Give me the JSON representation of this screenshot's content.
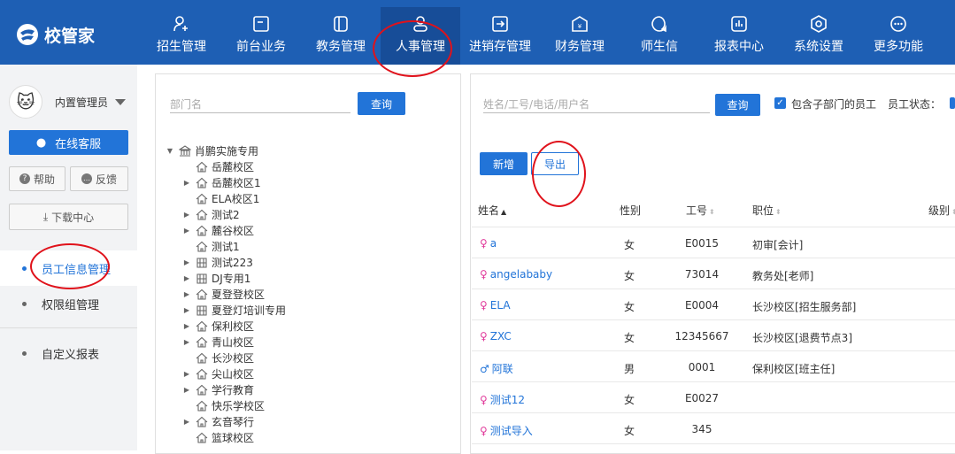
{
  "app": {
    "title": "校管家"
  },
  "nav": [
    {
      "label": "招生管理",
      "icon": "person-add-icon"
    },
    {
      "label": "前台业务",
      "icon": "monitor-icon"
    },
    {
      "label": "教务管理",
      "icon": "book-icon"
    },
    {
      "label": "人事管理",
      "icon": "person-icon",
      "active": true
    },
    {
      "label": "进销存管理",
      "icon": "inventory-icon"
    },
    {
      "label": "财务管理",
      "icon": "finance-icon"
    },
    {
      "label": "师生信",
      "icon": "chat-icon"
    },
    {
      "label": "报表中心",
      "icon": "report-icon"
    },
    {
      "label": "系统设置",
      "icon": "settings-icon"
    },
    {
      "label": "更多功能",
      "icon": "more-icon"
    }
  ],
  "sidebar": {
    "user": "内置管理员",
    "service": "在线客服",
    "help": "帮助",
    "feedback": "反馈",
    "download": "下载中心",
    "menu": [
      "员工信息管理",
      "权限组管理",
      "自定义报表"
    ]
  },
  "dept": {
    "placeholder": "部门名",
    "query": "查询",
    "tree": [
      {
        "label": "肖鹏实施专用",
        "arrow": "down",
        "icon": "bank-icon",
        "level": 0
      },
      {
        "label": "岳麓校区",
        "arrow": "",
        "icon": "home-icon",
        "level": 1
      },
      {
        "label": "岳麓校区1",
        "arrow": "right",
        "icon": "home-icon",
        "level": 1
      },
      {
        "label": "ELA校区1",
        "arrow": "",
        "icon": "home-icon",
        "level": 1
      },
      {
        "label": "测试2",
        "arrow": "right",
        "icon": "home-icon",
        "level": 1
      },
      {
        "label": "麓谷校区",
        "arrow": "right",
        "icon": "home-icon",
        "level": 1
      },
      {
        "label": "测试1",
        "arrow": "",
        "icon": "home-icon",
        "level": 1
      },
      {
        "label": "测试223",
        "arrow": "right",
        "icon": "org-icon",
        "level": 1
      },
      {
        "label": "DJ专用1",
        "arrow": "right",
        "icon": "org-icon",
        "level": 1
      },
      {
        "label": "夏登登校区",
        "arrow": "right",
        "icon": "home-icon",
        "level": 1
      },
      {
        "label": "夏登灯培训专用",
        "arrow": "right",
        "icon": "org-icon",
        "level": 1
      },
      {
        "label": "保利校区",
        "arrow": "right",
        "icon": "home-icon",
        "level": 1
      },
      {
        "label": "青山校区",
        "arrow": "right",
        "icon": "home-icon",
        "level": 1
      },
      {
        "label": "长沙校区",
        "arrow": "",
        "icon": "home-icon",
        "level": 1
      },
      {
        "label": "尖山校区",
        "arrow": "right",
        "icon": "home-icon",
        "level": 1
      },
      {
        "label": "学行教育",
        "arrow": "right",
        "icon": "home-icon",
        "level": 1
      },
      {
        "label": "快乐学校区",
        "arrow": "",
        "icon": "home-icon",
        "level": 1
      },
      {
        "label": "玄音琴行",
        "arrow": "right",
        "icon": "home-icon",
        "level": 1
      },
      {
        "label": "篮球校区",
        "arrow": "",
        "icon": "home-icon",
        "level": 1
      }
    ]
  },
  "staff": {
    "placeholder": "姓名/工号/电话/用户名",
    "query": "查询",
    "include_sub": "包含子部门的员工",
    "status_label": "员工状态：",
    "add": "新增",
    "export": "导出",
    "headers": [
      "姓名",
      "性别",
      "工号",
      "职位",
      "级别"
    ],
    "rows": [
      {
        "name": "a",
        "gender": "女",
        "id": "E0015",
        "position": "初审[会计]"
      },
      {
        "name": "angelababy",
        "gender": "女",
        "id": "73014",
        "position": "教务处[老师]"
      },
      {
        "name": "ELA",
        "gender": "女",
        "id": "E0004",
        "position": "长沙校区[招生服务部]"
      },
      {
        "name": "ZXC",
        "gender": "女",
        "id": "12345667",
        "position": "长沙校区[退费节点3]"
      },
      {
        "name": "阿联",
        "gender": "男",
        "id": "0001",
        "position": "保利校区[班主任]"
      },
      {
        "name": "测试12",
        "gender": "女",
        "id": "E0027",
        "position": ""
      },
      {
        "name": "测试导入",
        "gender": "女",
        "id": "345",
        "position": ""
      }
    ]
  },
  "colors": {
    "primary": "#1e5fb4",
    "accent": "#2274d8",
    "female": "#e0399a",
    "male": "#2274d8",
    "annotation": "#e0121b"
  }
}
